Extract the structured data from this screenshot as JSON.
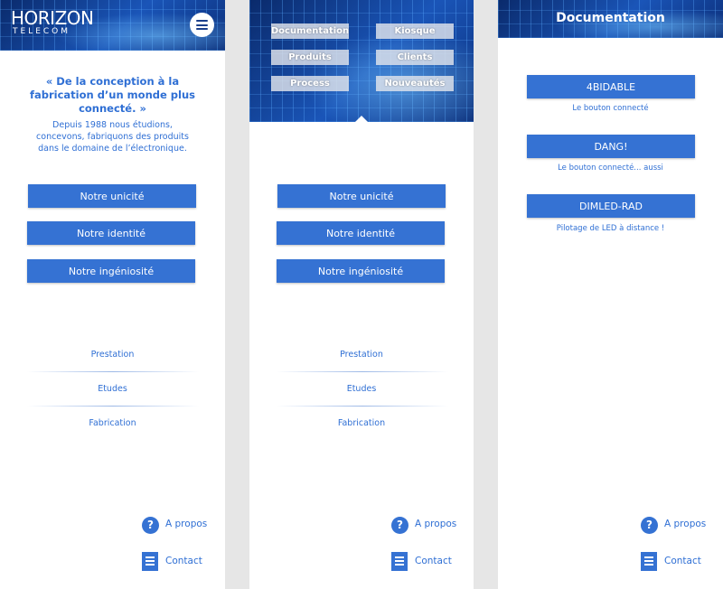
{
  "logo": {
    "main": "HORIZON",
    "sub": "TELECOM"
  },
  "quote": "« De la conception à la fabrication d’un monde plus connecté. »",
  "intro": "Depuis 1988 nous étudions, concevons, fabriquons des produits dans le domaine de l’électronique.",
  "main_buttons": [
    "Notre unicité",
    "Notre identité",
    "Notre ingéniosité"
  ],
  "tabs": [
    "Prestation",
    "Etudes",
    "Fabrication"
  ],
  "footer": {
    "about": "A propos",
    "contact": "Contact"
  },
  "menu": [
    "Documentation",
    "Kiosque",
    "Produits",
    "Clients",
    "Process",
    "Nouveautés"
  ],
  "documentation": {
    "title": "Documentation",
    "items": [
      {
        "label": "4BIDABLE",
        "caption": "Le bouton connecté"
      },
      {
        "label": "DANG!",
        "caption": "Le bouton connecté... aussi"
      },
      {
        "label": "DIMLED-RAD",
        "caption": "Pilotage de LED à distance !"
      }
    ]
  },
  "colors": {
    "accent": "#3572d3",
    "text_blue": "#2f6fd4",
    "header_dark": "#0a2a6b",
    "background_gray": "#e6e6e6"
  },
  "icons": [
    "menu-icon",
    "help-icon",
    "document-icon"
  ]
}
